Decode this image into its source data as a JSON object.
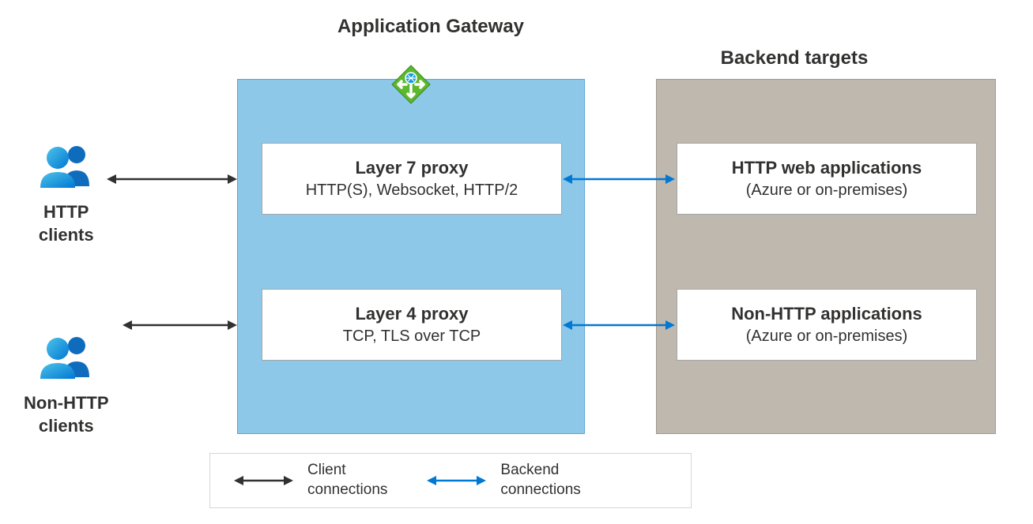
{
  "sections": {
    "gateway_title": "Application Gateway",
    "backend_title": "Backend targets"
  },
  "clients": [
    {
      "label_line1": "HTTP",
      "label_line2": "clients"
    },
    {
      "label_line1": "Non-HTTP",
      "label_line2": "clients"
    }
  ],
  "proxies": [
    {
      "title": "Layer 7 proxy",
      "subtitle": "HTTP(S), Websocket, HTTP/2"
    },
    {
      "title": "Layer 4 proxy",
      "subtitle": "TCP, TLS over TCP"
    }
  ],
  "targets": [
    {
      "title": "HTTP web applications",
      "subtitle": "(Azure or on-premises)"
    },
    {
      "title": "Non-HTTP applications",
      "subtitle": "(Azure or on-premises)"
    }
  ],
  "legend": {
    "client": "Client\nconnections",
    "backend": "Backend\nconnections"
  },
  "colors": {
    "gateway_bg": "#8dc8e8",
    "backend_bg": "#bfb8af",
    "client_arrow": "#323130",
    "backend_arrow": "#0078d4"
  }
}
